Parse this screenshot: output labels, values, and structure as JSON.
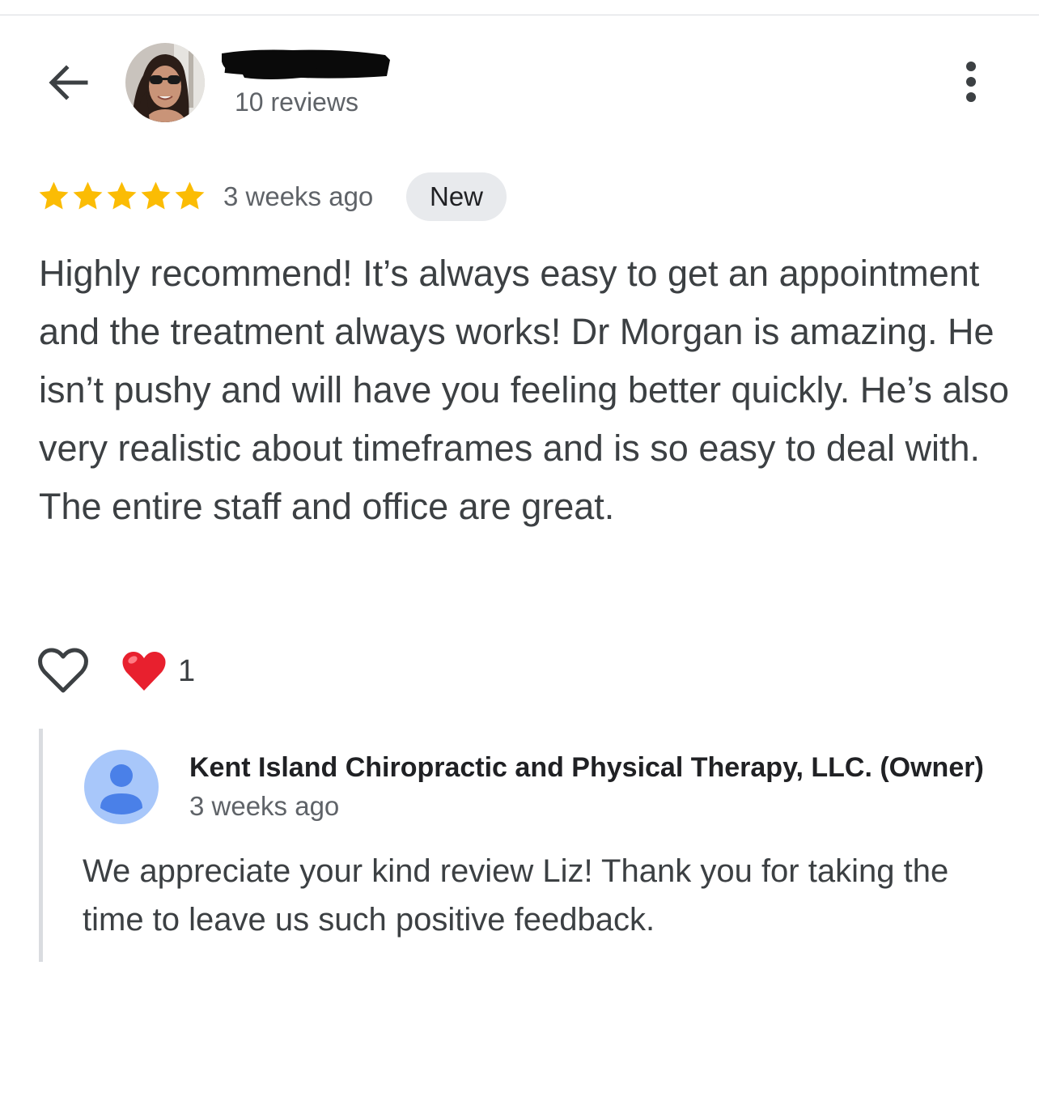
{
  "header": {
    "back_icon": "arrow-left-icon",
    "reviewer_name": "",
    "review_count": "10 reviews",
    "more_icon": "more-vertical-icon"
  },
  "review": {
    "rating": 5,
    "max_rating": 5,
    "star_color": "#fbbc04",
    "date": "3 weeks ago",
    "badge": "New",
    "text": "Highly recommend! It’s always easy to get an appointment and the treatment always works! Dr Morgan is amazing. He isn’t pushy and will have you feeling better quickly. He’s also very realistic about timeframes and is so easy to deal with. The entire staff and office are great."
  },
  "reactions": {
    "like_icon": "heart-outline-icon",
    "reaction_icon": "red-heart-icon",
    "count": "1"
  },
  "owner_reply": {
    "name": "Kent Island Chiropractic and Physical Therapy, LLC. (Owner)",
    "date": "3 weeks ago",
    "text": "We appreciate your kind review Liz! Thank you for taking the time to leave us such positive feedback.",
    "avatar_color": "#a8c7fa",
    "avatar_figure_color": "#4a80e8"
  }
}
